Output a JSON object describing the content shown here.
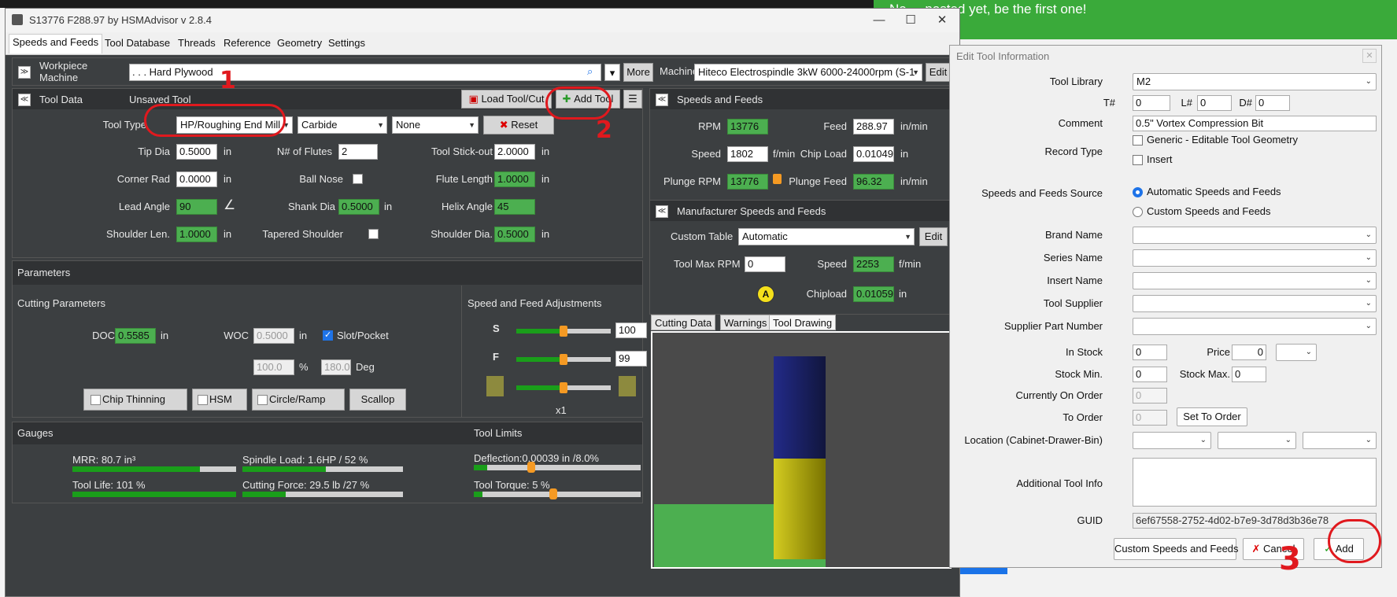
{
  "background": {
    "notice_text": "No ... posted yet, be the first one!"
  },
  "window": {
    "title": "S13776 F288.97 by HSMAdvisor v 2.8.4",
    "minimize": "—",
    "maximize": "☐",
    "close": "✕"
  },
  "menu": {
    "tabs": [
      "Speeds and Feeds",
      "Tool Database",
      "Threads",
      "Reference",
      "Geometry",
      "Settings"
    ]
  },
  "workpiece": {
    "label": "Workpiece Machine",
    "material": ". . . Hard Plywood",
    "more_button": "More",
    "machine_label": "Machine",
    "machine": "Hiteco Electrospindle 3kW 6000-24000rpm (S-1",
    "edit_button": "Edit"
  },
  "tool_data": {
    "header": "Tool Data",
    "unsaved": "Unsaved Tool",
    "load_button": "Load Tool/Cut",
    "add_button": "Add Tool",
    "tool_type_label": "Tool Type",
    "tool_type": "HP/Roughing End Mill",
    "material": "Carbide",
    "coating": "None",
    "reset_button": "Reset",
    "tip_dia_label": "Tip Dia",
    "tip_dia": "0.5000",
    "flutes_label": "N# of Flutes",
    "flutes": "2",
    "stickout_label": "Tool Stick-out",
    "stickout": "2.0000",
    "corner_rad_label": "Corner Rad",
    "corner_rad": "0.0000",
    "ball_nose_label": "Ball Nose",
    "flute_length_label": "Flute Length",
    "flute_length": "1.0000",
    "lead_angle_label": "Lead Angle",
    "lead_angle": "90",
    "shank_dia_label": "Shank Dia",
    "shank_dia": "0.5000",
    "helix_angle_label": "Helix Angle",
    "helix_angle": "45",
    "shoulder_len_label": "Shoulder Len.",
    "shoulder_len": "1.0000",
    "tapered_shoulder_label": "Tapered Shoulder",
    "shoulder_dia_label": "Shoulder Dia.",
    "shoulder_dia": "0.5000",
    "unit": "in"
  },
  "speeds_feeds": {
    "header": "Speeds and Feeds",
    "rpm_label": "RPM",
    "rpm": "13776",
    "feed_label": "Feed",
    "feed": "288.97",
    "feed_unit": "in/min",
    "speed_label": "Speed",
    "speed": "1802",
    "speed_unit": "f/min",
    "chip_load_label": "Chip Load",
    "chip_load": "0.01049",
    "chip_unit": "in",
    "plunge_rpm_label": "Plunge RPM",
    "plunge_rpm": "13776",
    "plunge_feed_label": "Plunge Feed",
    "plunge_feed": "96.32",
    "plunge_unit": "in/min"
  },
  "manufacturer": {
    "header": "Manufacturer Speeds and Feeds",
    "custom_table_label": "Custom Table",
    "custom_table": "Automatic",
    "edit_button": "Edit",
    "max_rpm_label": "Tool Max RPM",
    "max_rpm": "0",
    "speed_label": "Speed",
    "speed": "2253",
    "speed_unit": "f/min",
    "badge": "A",
    "chipload_label": "Chipload",
    "chipload": "0.01059",
    "chipload_unit": "in"
  },
  "drawing_tabs": [
    "Cutting Data",
    "Warnings",
    "Tool Drawing"
  ],
  "parameters": {
    "header": "Parameters",
    "cutting_label": "Cutting Parameters",
    "doc_label": "DOC",
    "doc": "0.5585",
    "woc_label": "WOC",
    "woc": "0.5000",
    "slot_label": "Slot/Pocket",
    "woc_pct": "100.0",
    "pct_unit": "%",
    "angle": "180.0",
    "deg_unit": "Deg",
    "unit": "in",
    "chip_thinning": "Chip Thinning",
    "hsm": "HSM",
    "circle_ramp": "Circle/Ramp",
    "scallop": "Scallop",
    "adjust_label": "Speed and Feed Adjustments",
    "s_label": "S",
    "s_value": "100",
    "s_level": 0.5,
    "f_label": "F",
    "f_value": "99",
    "f_level": 0.5,
    "z_level": 0.5,
    "multiplier": "x1"
  },
  "gauges": {
    "header": "Gauges",
    "mrr": "MRR: 80.7 in³",
    "mrr_level": 0.78,
    "spindle": "Spindle Load: 1.6HP / 52 %",
    "spindle_level": 0.52,
    "tool_life": "Tool Life: 101 %",
    "tool_life_level": 1.0,
    "cutting_force": "Cutting Force: 29.5 lb /27 %",
    "cutting_force_level": 0.27,
    "limits_header": "Tool Limits",
    "deflection": "Deflection:0.00039 in /8.0%",
    "deflection_level": 0.08,
    "torque": "Tool Torque: 5 %",
    "torque_level": 0.05
  },
  "dialog": {
    "title": "Edit Tool Information",
    "tool_library_label": "Tool Library",
    "tool_library": "M2",
    "t_label": "T#",
    "t_value": "0",
    "l_label": "L#",
    "l_value": "0",
    "d_label": "D#",
    "d_value": "0",
    "comment_label": "Comment",
    "comment": "0.5\" Vortex Compression Bit",
    "record_type_label": "Record Type",
    "record_generic": "Generic - Editable Tool Geometry",
    "record_insert": "Insert",
    "source_label": "Speeds and Feeds Source",
    "source_auto": "Automatic Speeds and Feeds",
    "source_custom": "Custom Speeds and Feeds",
    "brand_label": "Brand Name",
    "series_label": "Series Name",
    "insert_name_label": "Insert Name",
    "supplier_label": "Tool Supplier",
    "supplier_part_label": "Supplier Part Number",
    "in_stock_label": "In Stock",
    "in_stock": "0",
    "price_label": "Price",
    "price": "0",
    "stock_min_label": "Stock Min.",
    "stock_min": "0",
    "stock_max_label": "Stock Max.",
    "stock_max": "0",
    "on_order_label": "Currently On Order",
    "on_order": "0",
    "to_order_label": "To Order",
    "to_order": "0",
    "set_to_order": "Set To Order",
    "location_label": "Location (Cabinet-Drawer-Bin)",
    "additional_label": "Additional Tool Info",
    "guid_label": "GUID",
    "guid": "6ef67558-2752-4d02-b7e9-3d78d3b36e78",
    "custom_button": "Custom Speeds and Feeds",
    "cancel_button": "Cancel",
    "add_button": "Add"
  },
  "annotations": [
    "1",
    "2",
    "3"
  ]
}
